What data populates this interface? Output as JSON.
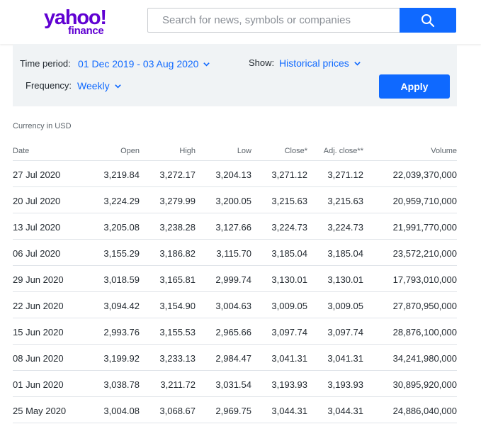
{
  "header": {
    "logo_text": "yahoo!",
    "logo_sub": "finance",
    "search_placeholder": "Search for news, symbols or companies",
    "brand_color": "#6001d2",
    "accent_color": "#0f69ff"
  },
  "controls": {
    "time_period_label": "Time period:",
    "time_period_value": "01 Dec 2019 - 03 Aug 2020",
    "show_label": "Show:",
    "show_value": "Historical prices",
    "frequency_label": "Frequency:",
    "frequency_value": "Weekly",
    "apply_label": "Apply"
  },
  "currency_note": "Currency in USD",
  "table": {
    "headers": [
      "Date",
      "Open",
      "High",
      "Low",
      "Close*",
      "Adj. close**",
      "Volume"
    ],
    "rows": [
      [
        "27 Jul 2020",
        "3,219.84",
        "3,272.17",
        "3,204.13",
        "3,271.12",
        "3,271.12",
        "22,039,370,000"
      ],
      [
        "20 Jul 2020",
        "3,224.29",
        "3,279.99",
        "3,200.05",
        "3,215.63",
        "3,215.63",
        "20,959,710,000"
      ],
      [
        "13 Jul 2020",
        "3,205.08",
        "3,238.28",
        "3,127.66",
        "3,224.73",
        "3,224.73",
        "21,991,770,000"
      ],
      [
        "06 Jul 2020",
        "3,155.29",
        "3,186.82",
        "3,115.70",
        "3,185.04",
        "3,185.04",
        "23,572,210,000"
      ],
      [
        "29 Jun 2020",
        "3,018.59",
        "3,165.81",
        "2,999.74",
        "3,130.01",
        "3,130.01",
        "17,793,010,000"
      ],
      [
        "22 Jun 2020",
        "3,094.42",
        "3,154.90",
        "3,004.63",
        "3,009.05",
        "3,009.05",
        "27,870,950,000"
      ],
      [
        "15 Jun 2020",
        "2,993.76",
        "3,155.53",
        "2,965.66",
        "3,097.74",
        "3,097.74",
        "28,876,100,000"
      ],
      [
        "08 Jun 2020",
        "3,199.92",
        "3,233.13",
        "2,984.47",
        "3,041.31",
        "3,041.31",
        "34,241,980,000"
      ],
      [
        "01 Jun 2020",
        "3,038.78",
        "3,211.72",
        "3,031.54",
        "3,193.93",
        "3,193.93",
        "30,895,920,000"
      ],
      [
        "25 May 2020",
        "3,004.08",
        "3,068.67",
        "2,969.75",
        "3,044.31",
        "3,044.31",
        "24,886,040,000"
      ]
    ]
  }
}
